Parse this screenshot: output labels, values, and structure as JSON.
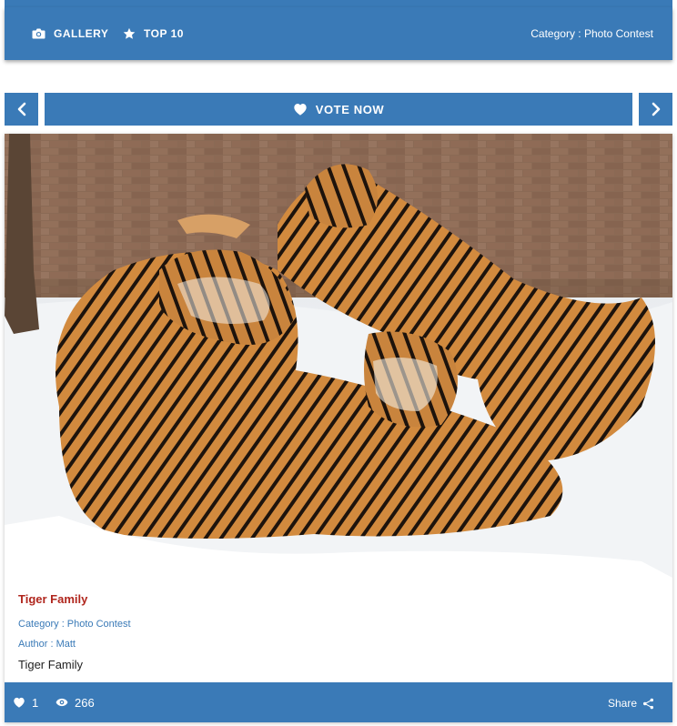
{
  "nav": {
    "gallery_label": "GALLERY",
    "top10_label": "TOP 10",
    "category_text": "Category : Photo Contest"
  },
  "vote": {
    "label": "VOTE NOW"
  },
  "entry": {
    "title": "Tiger Family",
    "category": "Category : Photo Contest",
    "author": "Author : Matt",
    "description": "Tiger Family"
  },
  "stats": {
    "likes": "1",
    "views": "266",
    "share_label": "Share"
  },
  "colors": {
    "primary": "#3a7ab7",
    "title_red": "#b0261d",
    "meta_blue": "#3a7ab7"
  },
  "icons": {
    "gallery": "camera-icon",
    "top10": "star-icon",
    "vote": "heart-icon",
    "prev": "chevron-left-icon",
    "next": "chevron-right-icon",
    "like": "heart-icon",
    "views": "eye-icon",
    "share": "share-icon"
  }
}
